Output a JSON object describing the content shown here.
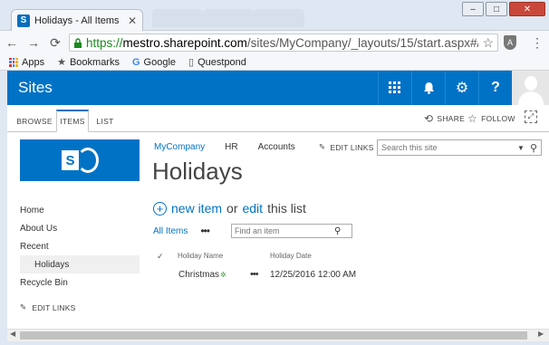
{
  "browser": {
    "tab_title": "Holidays - All Items",
    "tab_favicon": "S",
    "url_https": "https://",
    "url_host": "mestro.sharepoint.com",
    "url_path": "/sites/MyCompany/_layouts/15/start.aspx#/Lists/Holid",
    "bookmarks": [
      "Apps",
      "Bookmarks",
      "Google",
      "Questpond"
    ]
  },
  "suitebar": {
    "title": "Sites"
  },
  "ribbon": {
    "tabs": [
      "BROWSE",
      "ITEMS",
      "LIST"
    ],
    "share": "SHARE",
    "follow": "FOLLOW"
  },
  "topnav": {
    "items": [
      "MyCompany",
      "HR",
      "Accounts"
    ],
    "edit_links": "EDIT LINKS",
    "search_placeholder": "Search this site"
  },
  "page": {
    "title": "Holidays",
    "new_item": "new item",
    "or": "or",
    "edit": "edit",
    "this_list": "this list",
    "view": "All Items",
    "view_more": "•••",
    "find_placeholder": "Find an item"
  },
  "quicklaunch": {
    "items": [
      "Home",
      "About Us",
      "Recent",
      "Holidays",
      "Recycle Bin"
    ],
    "edit_links": "EDIT LINKS"
  },
  "list": {
    "columns": [
      "Holiday Name",
      "Holiday Date"
    ],
    "rows": [
      {
        "name": "Christmas",
        "ellipsis": "•••",
        "date": "12/25/2016 12:00 AM"
      }
    ]
  },
  "colors": {
    "sharepoint_blue": "#0072c6",
    "link_blue": "#0072c6",
    "suite_text": "#ffffff"
  }
}
